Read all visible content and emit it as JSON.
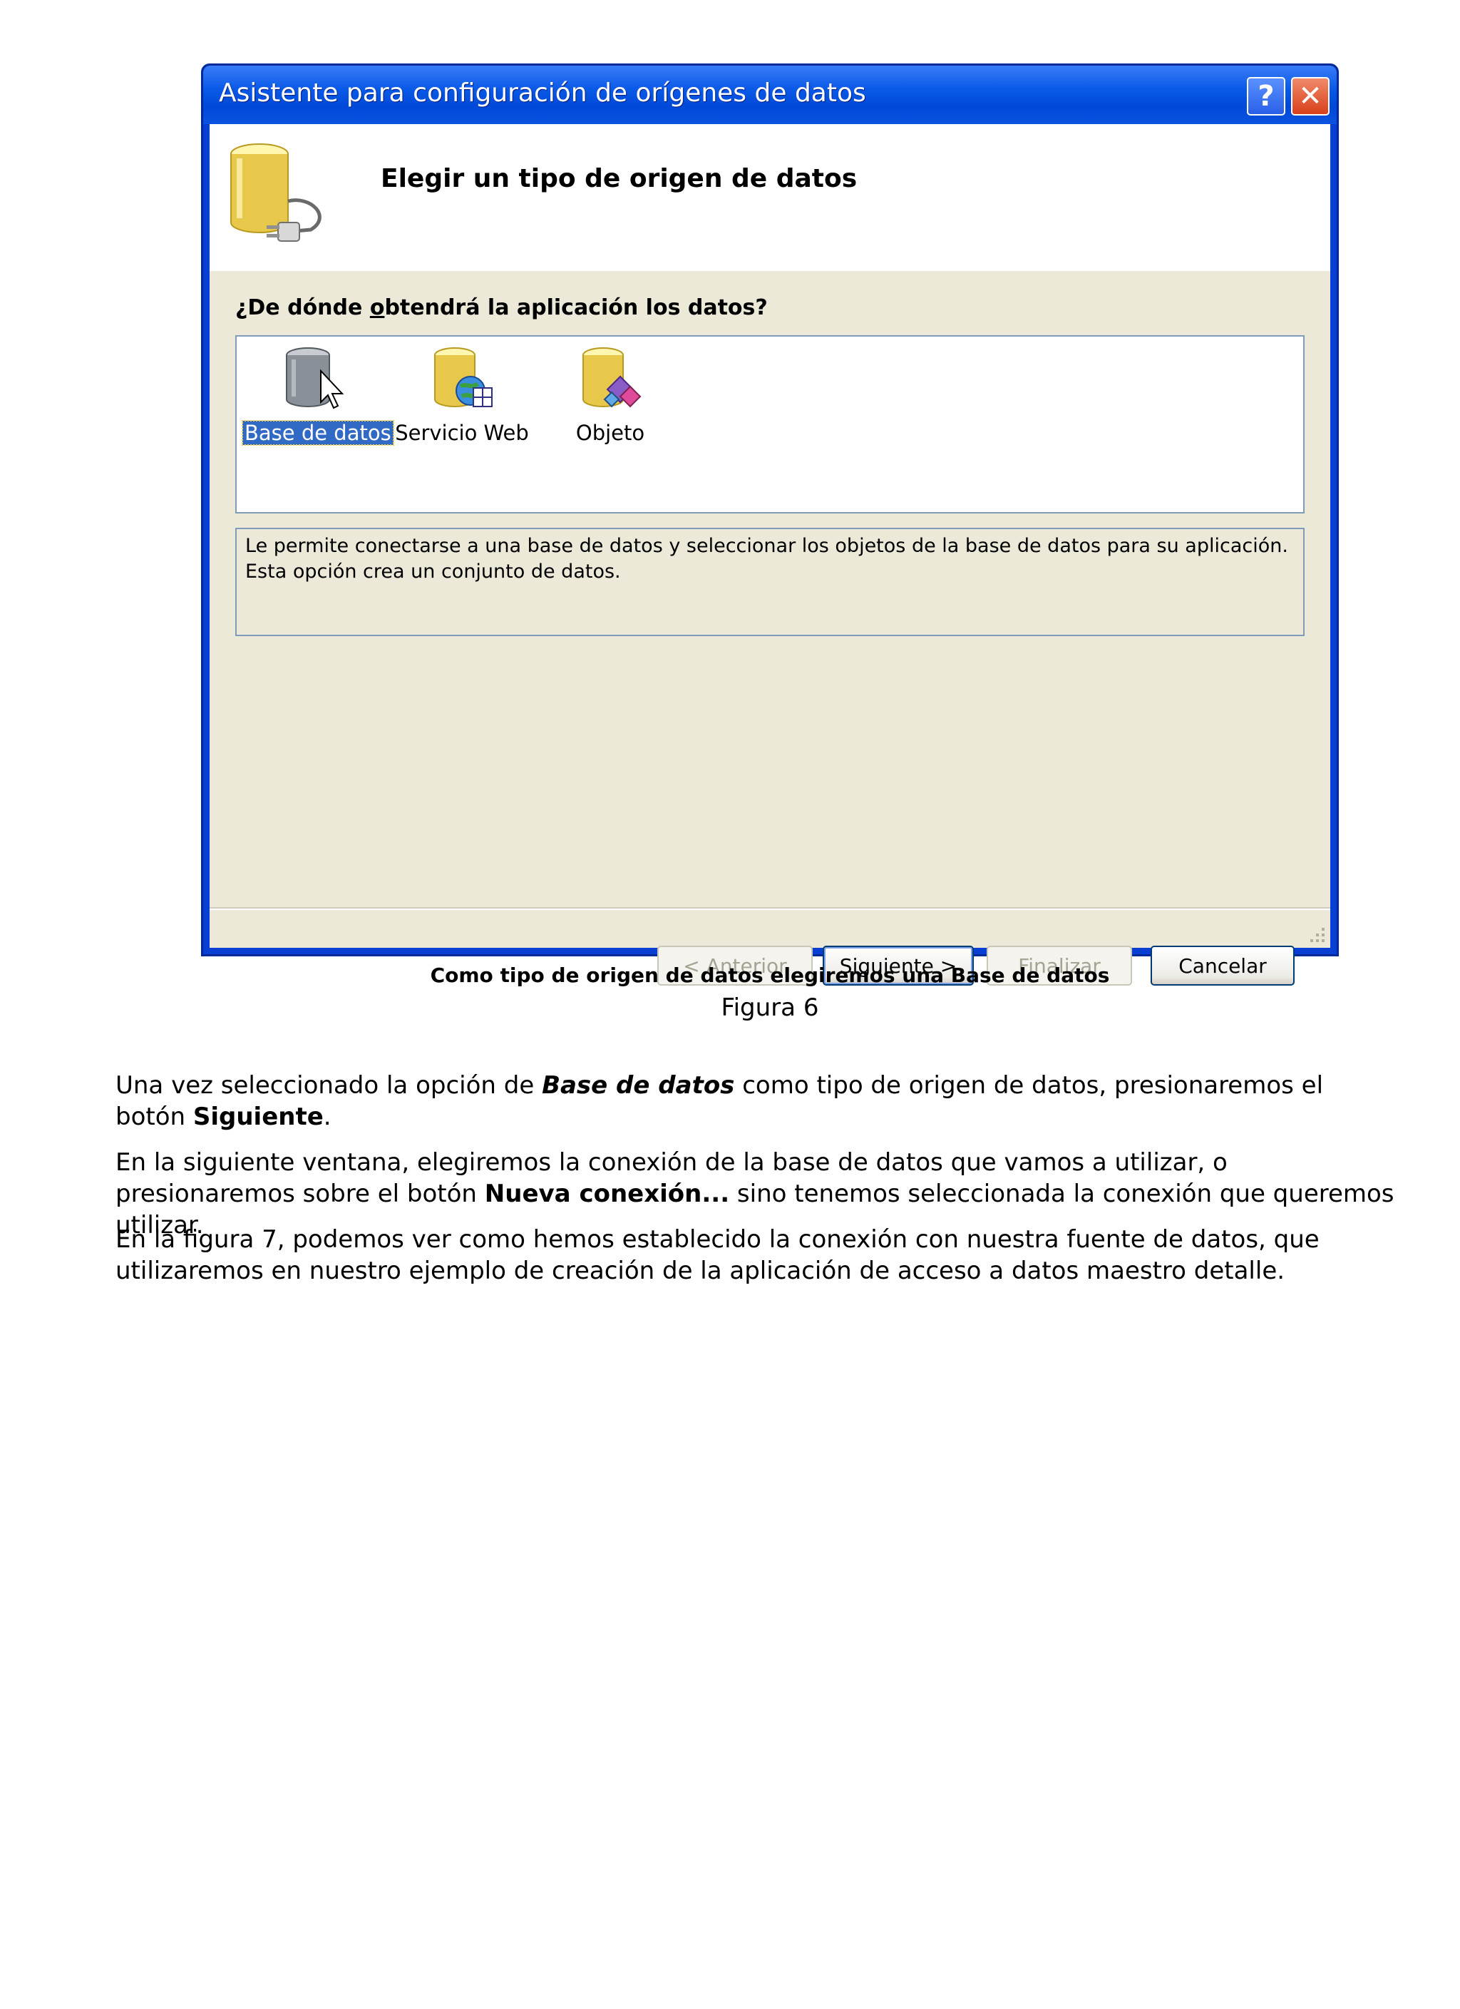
{
  "dialog": {
    "title": "Asistente para configuración de orígenes de datos",
    "help_glyph": "?",
    "close_glyph": "✕",
    "header_title": "Elegir un tipo de origen de datos",
    "question_prefix": "¿De dónde ",
    "question_underlined": "o",
    "question_suffix": "btendrá la aplicación los datos?",
    "items": [
      {
        "label": "Base de datos",
        "icon": "database-icon",
        "selected": true
      },
      {
        "label": "Servicio Web",
        "icon": "web-service-icon",
        "selected": false
      },
      {
        "label": "Objeto",
        "icon": "object-icon",
        "selected": false
      }
    ],
    "description_line1": "Le permite conectarse a una base de datos y seleccionar los objetos de la base de datos para su aplicación.",
    "description_line2": "Esta opción crea un conjunto de datos.",
    "buttons": {
      "back": "< Anterior",
      "next": "Siguiente >",
      "finish": "Finalizar",
      "cancel": "Cancelar"
    }
  },
  "document": {
    "caption": "Como tipo de origen de datos elegiremos una Base de datos",
    "figure_label": "Figura 6",
    "p1_a": "Una vez seleccionado la opción de ",
    "p1_b": "Base de datos",
    "p1_c": " como tipo de origen de datos, presionaremos el botón ",
    "p1_d": "Siguiente",
    "p1_e": ".",
    "p2_a": "En la siguiente ventana, elegiremos la conexión de la base de datos que vamos a utilizar, o presionaremos sobre el botón ",
    "p2_b": "Nueva conexión...",
    "p2_c": " sino tenemos seleccionada la conexión que queremos utilizar.",
    "p3": "En la figura 7, podemos ver como hemos establecido la conexión con nuestra fuente de datos, que utilizaremos en nuestro ejemplo de creación de la aplicación de acceso a datos maestro detalle."
  },
  "colors": {
    "titlebar": "#0a5ae8",
    "selection": "#316ac5",
    "dialog_face": "#ece9d8",
    "database_gold": "#e8c84a"
  }
}
